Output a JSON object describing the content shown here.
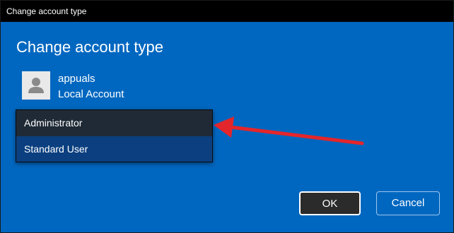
{
  "window": {
    "title": "Change account type"
  },
  "dialog": {
    "heading": "Change account type",
    "account": {
      "name": "appuals",
      "type": "Local Account",
      "avatar_icon": "user-silhouette-icon"
    },
    "dropdown": {
      "options": [
        "Administrator",
        "Standard User"
      ],
      "highlighted": "Standard User"
    },
    "buttons": {
      "ok": "OK",
      "cancel": "Cancel"
    }
  },
  "annotation": {
    "arrow_color": "#e3262b",
    "arrow_icon": "red-arrow-pointing-left"
  },
  "colors": {
    "dialog_bg": "#0067c0",
    "titlebar_bg": "#000000",
    "dropdown_bg": "#1f2a36",
    "selected_bg": "#0b3f7f"
  }
}
